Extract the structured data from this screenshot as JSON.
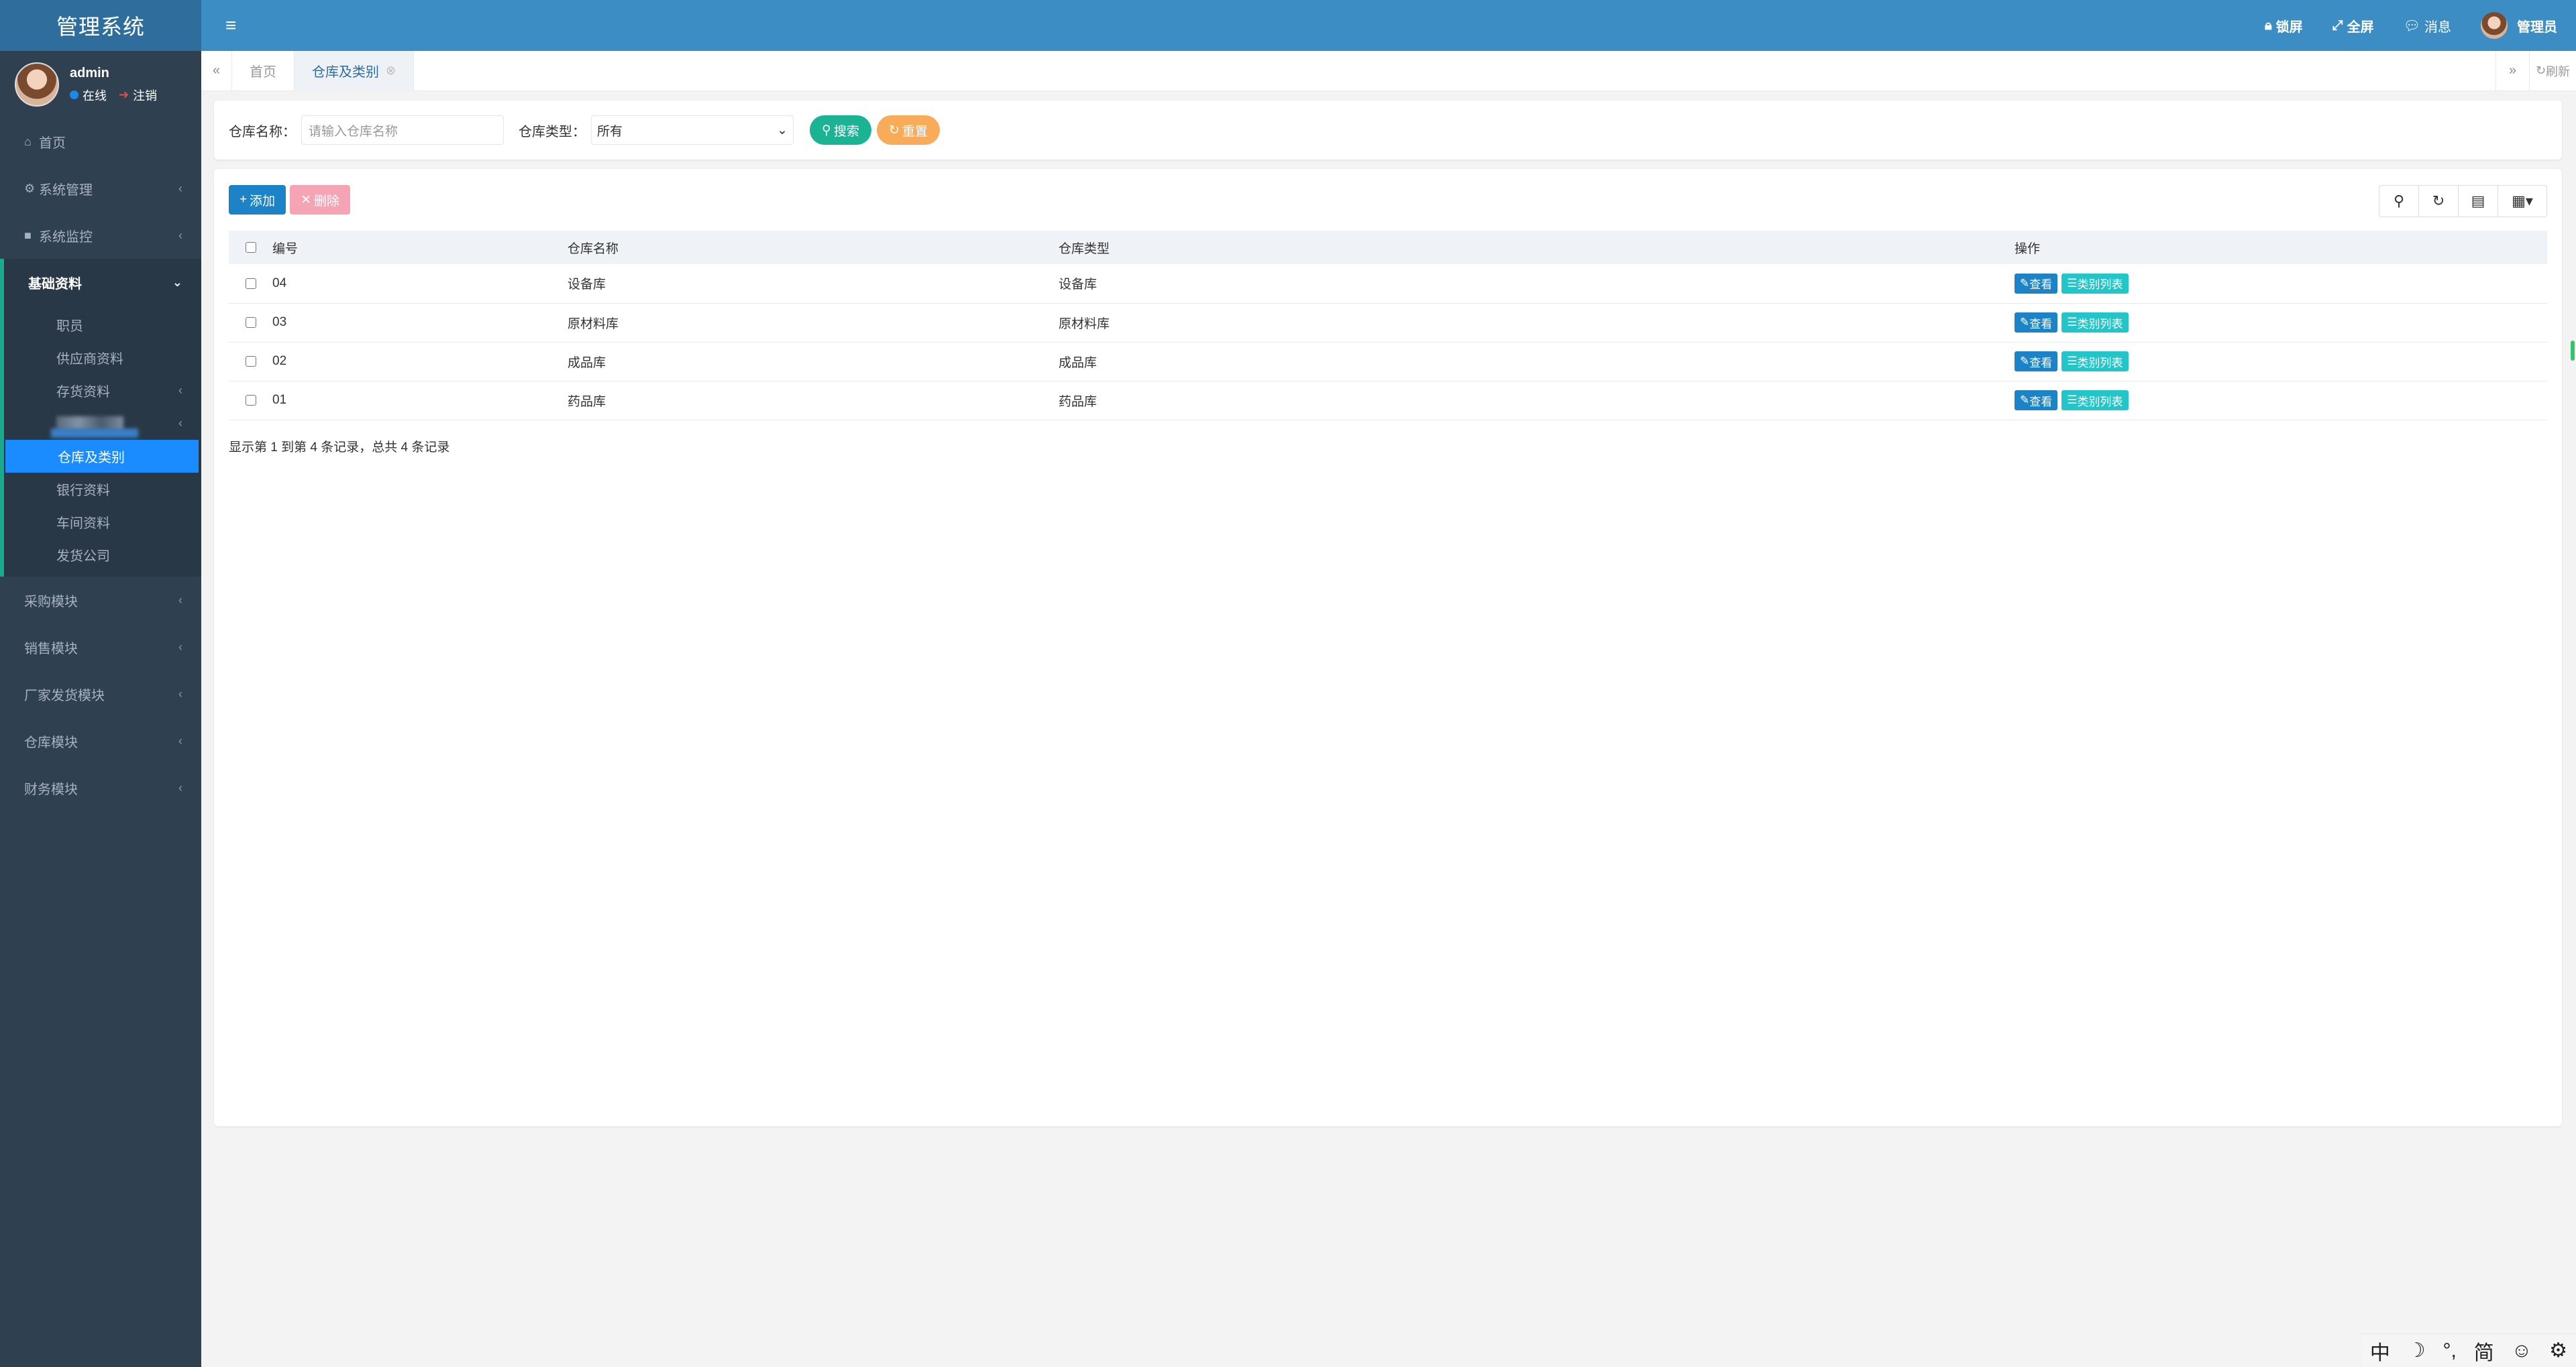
{
  "app": {
    "title": "管理系统"
  },
  "user": {
    "name": "admin",
    "status": "在线",
    "logout": "注销"
  },
  "sidebar": {
    "items": [
      {
        "label": "首页",
        "icon": "home-icon"
      },
      {
        "label": "系统管理",
        "icon": "gear-icon"
      },
      {
        "label": "系统监控",
        "icon": "video-icon"
      },
      {
        "label": "基础资料",
        "icon": ""
      }
    ],
    "sub_items": [
      {
        "label": "职员"
      },
      {
        "label": "供应商资料"
      },
      {
        "label": "存货资料"
      },
      {
        "label": ""
      },
      {
        "label": "仓库及类别"
      },
      {
        "label": "银行资料"
      },
      {
        "label": "车间资料"
      },
      {
        "label": "发货公司"
      }
    ],
    "modules": [
      {
        "label": "采购模块"
      },
      {
        "label": "销售模块"
      },
      {
        "label": "厂家发货模块"
      },
      {
        "label": "仓库模块"
      },
      {
        "label": "财务模块"
      }
    ]
  },
  "topbar": {
    "lock": "锁屏",
    "fullscreen": "全屏",
    "messages": "消息",
    "admin": "管理员"
  },
  "tabs": [
    {
      "label": "首页"
    },
    {
      "label": "仓库及类别"
    }
  ],
  "tabs_refresh": "刷新",
  "search": {
    "name_label": "仓库名称：",
    "name_placeholder": "请输入仓库名称",
    "type_label": "仓库类型：",
    "type_value": "所有",
    "search_btn": "搜索",
    "reset_btn": "重置"
  },
  "toolbar": {
    "add": "添加",
    "delete": "删除"
  },
  "table": {
    "headers": {
      "id": "编号",
      "name": "仓库名称",
      "type": "仓库类型",
      "op": "操作"
    },
    "rows": [
      {
        "id": "04",
        "name": "设备库",
        "type": "设备库"
      },
      {
        "id": "03",
        "name": "原材料库",
        "type": "原材料库"
      },
      {
        "id": "02",
        "name": "成品库",
        "type": "成品库"
      },
      {
        "id": "01",
        "name": "药品库",
        "type": "药品库"
      }
    ],
    "op_view": "查看",
    "op_list": "类别列表"
  },
  "summary": "显示第 1 到第 4 条记录，总共 4 条记录",
  "ime": {
    "lang": "中",
    "moon": "☽",
    "punct": "°,",
    "simp": "简",
    "emoji": "☺",
    "settings": "⚙"
  }
}
